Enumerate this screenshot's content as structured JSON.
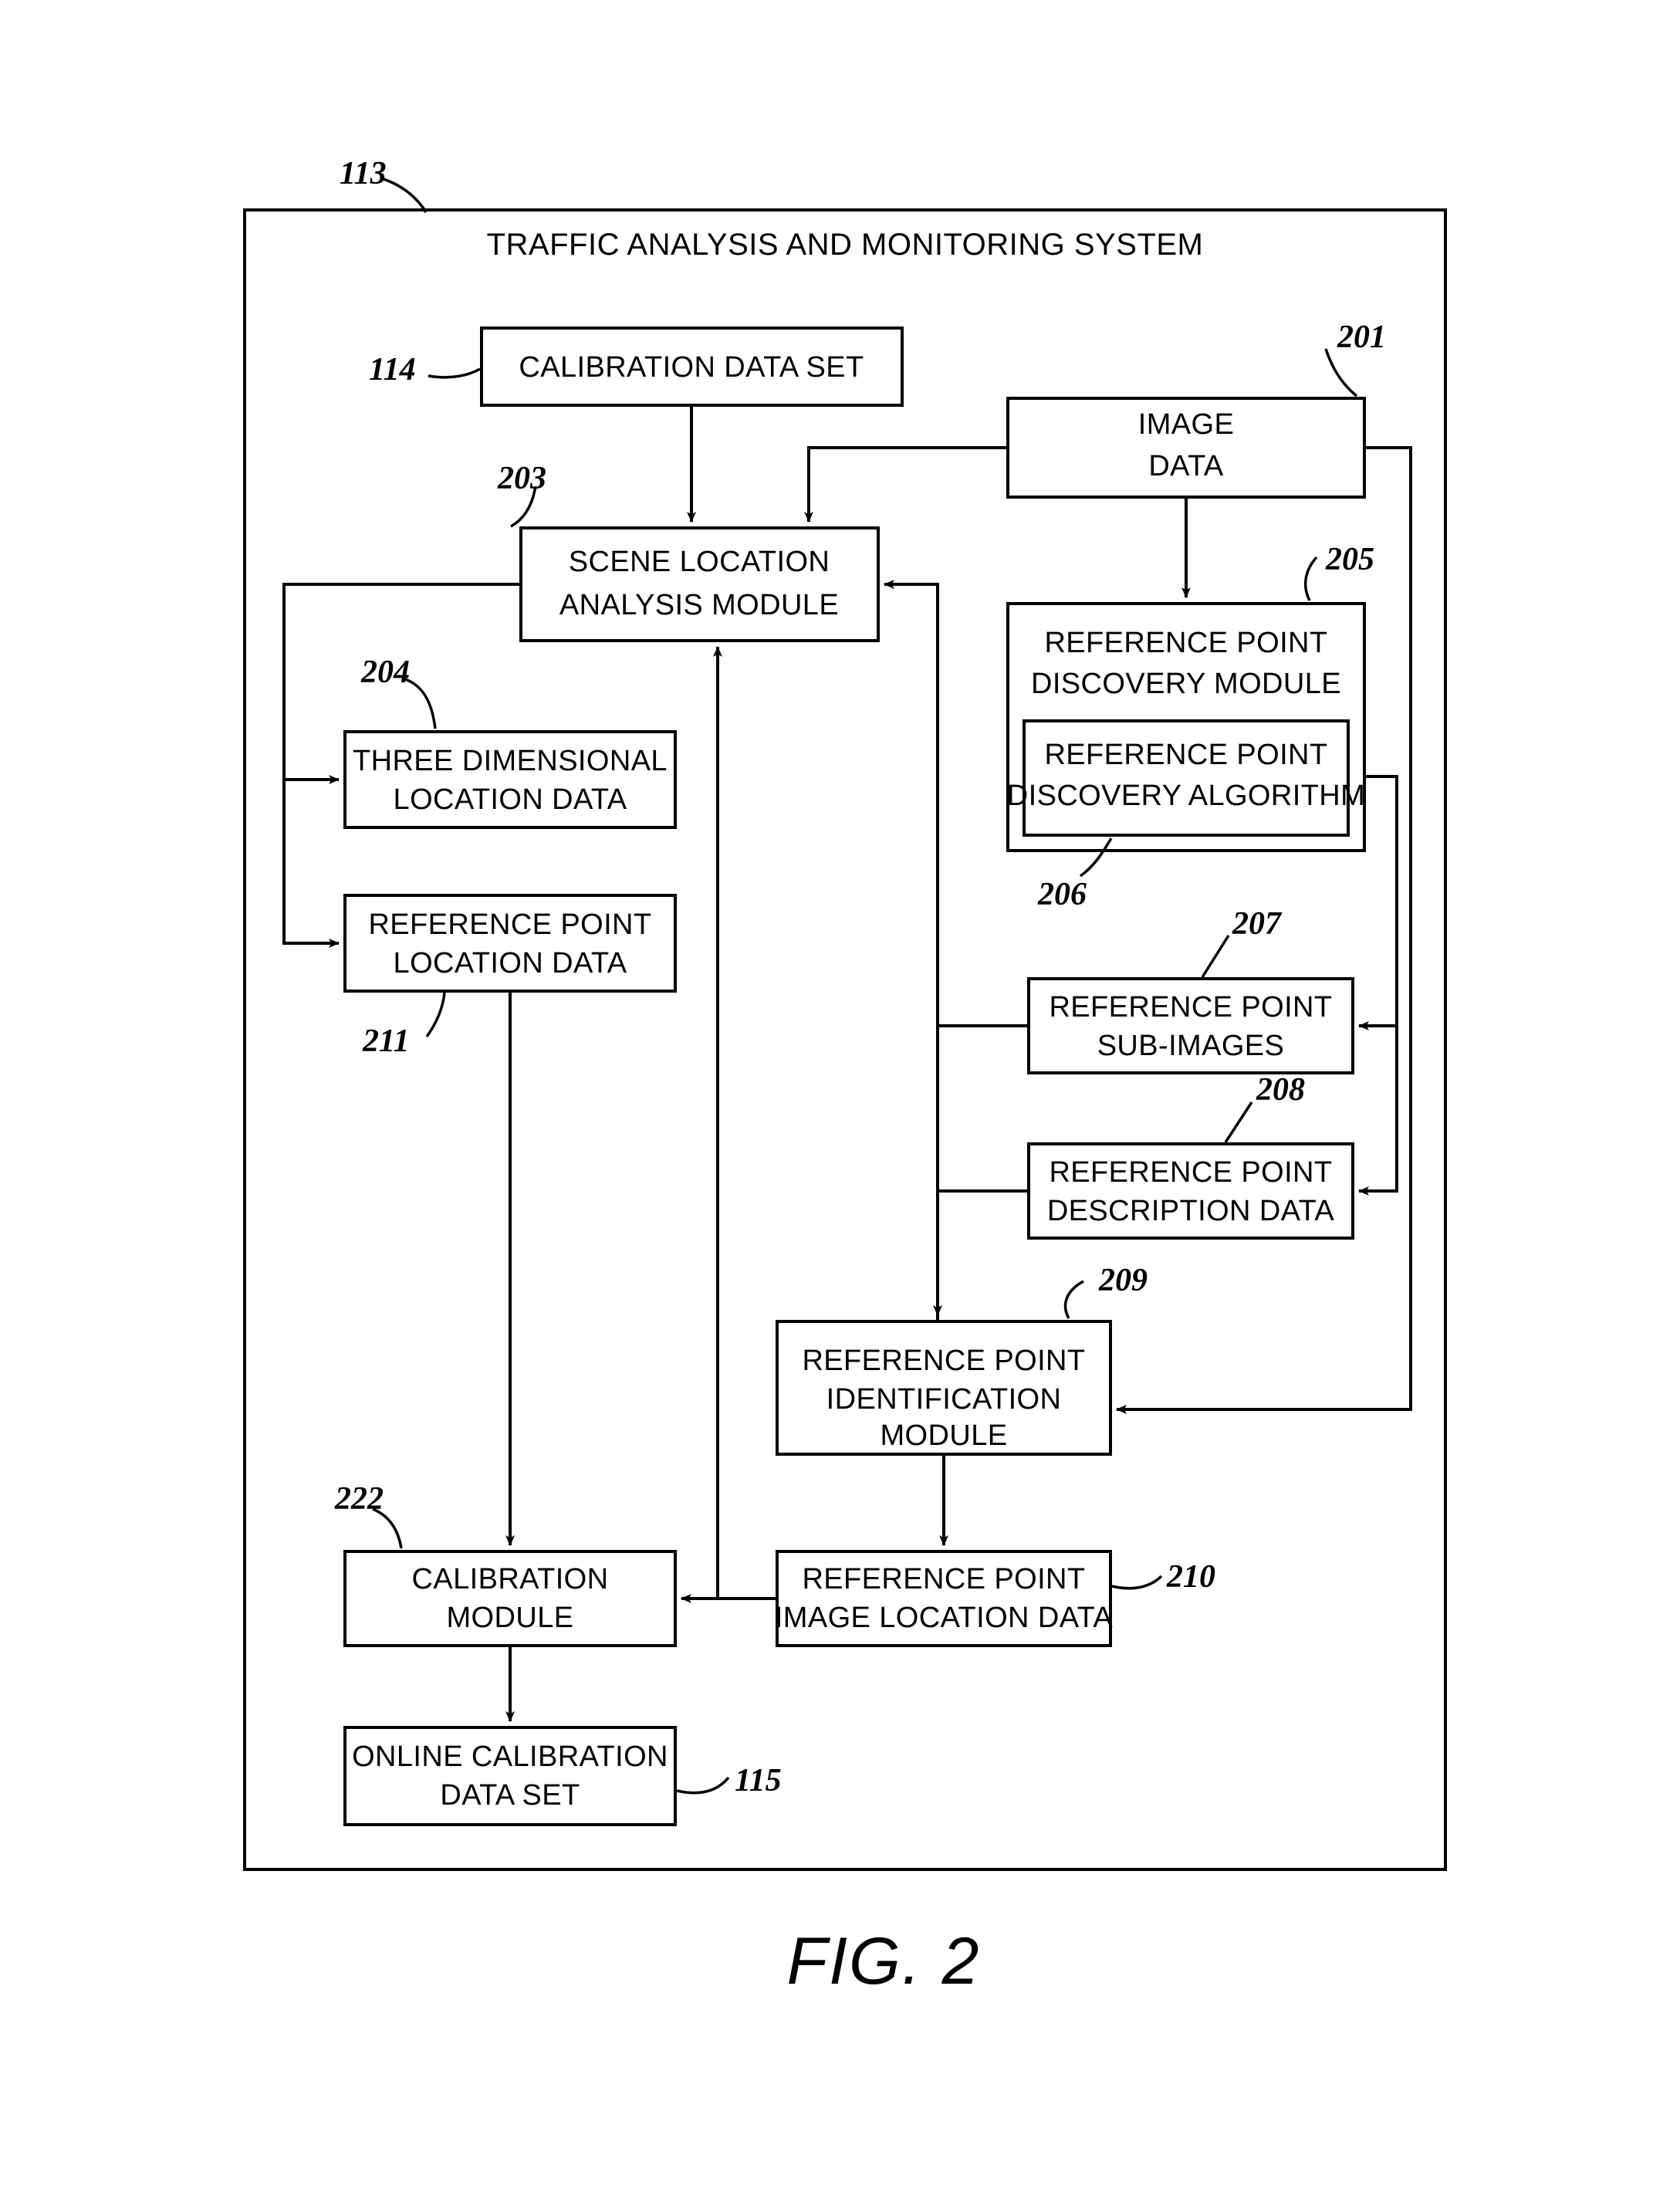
{
  "figure": {
    "caption": "FIG. 2",
    "system_title": "TRAFFIC ANALYSIS AND MONITORING SYSTEM",
    "system_ref": "113"
  },
  "boxes": {
    "calibration_data_set": {
      "label": "CALIBRATION DATA SET",
      "ref": "114"
    },
    "image_data": {
      "line1": "IMAGE",
      "line2": "DATA",
      "ref": "201"
    },
    "scene_location_analysis_module": {
      "line1": "SCENE LOCATION",
      "line2": "ANALYSIS MODULE",
      "ref": "203"
    },
    "three_dimensional_location_data": {
      "line1": "THREE DIMENSIONAL",
      "line2": "LOCATION DATA",
      "ref": "204"
    },
    "reference_point_location_data": {
      "line1": "REFERENCE POINT",
      "line2": "LOCATION DATA",
      "ref": "211"
    },
    "reference_point_discovery_module": {
      "line1": "REFERENCE POINT",
      "line2": "DISCOVERY MODULE",
      "ref": "205"
    },
    "reference_point_discovery_algorithm": {
      "line1": "REFERENCE POINT",
      "line2": "DISCOVERY ALGORITHM",
      "ref": "206"
    },
    "reference_point_sub_images": {
      "line1": "REFERENCE POINT",
      "line2": "SUB-IMAGES",
      "ref": "207"
    },
    "reference_point_description_data": {
      "line1": "REFERENCE POINT",
      "line2": "DESCRIPTION DATA",
      "ref": "208"
    },
    "reference_point_identification_module": {
      "line1": "REFERENCE POINT",
      "line2": "IDENTIFICATION",
      "line3": "MODULE",
      "ref": "209"
    },
    "reference_point_image_location_data": {
      "line1": "REFERENCE POINT",
      "line2": "IMAGE LOCATION DATA",
      "ref": "210"
    },
    "calibration_module": {
      "line1": "CALIBRATION",
      "line2": "MODULE",
      "ref": "222"
    },
    "online_calibration_data_set": {
      "line1": "ONLINE CALIBRATION",
      "line2": "DATA SET",
      "ref": "115"
    }
  },
  "colors": {
    "stroke": "#000000",
    "background": "#ffffff",
    "text": "#000000"
  }
}
